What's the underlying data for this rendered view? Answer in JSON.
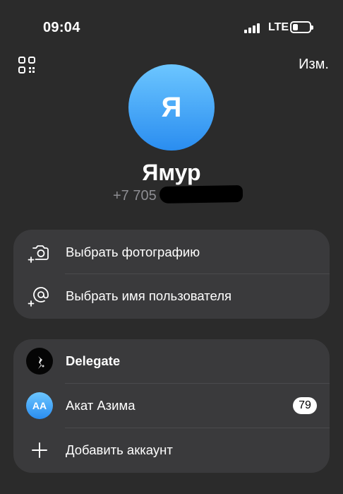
{
  "status_bar": {
    "time": "09:04",
    "network": "LTE",
    "battery_level": 0.15
  },
  "header": {
    "qr_icon": "qr-code-icon",
    "edit_label": "Изм."
  },
  "profile": {
    "avatar_letter": "Я",
    "name": "Ямур",
    "phone_visible": "+7 705",
    "avatar_colors": [
      "#6cc6ff",
      "#2a8df0"
    ]
  },
  "menu": {
    "items": [
      {
        "label": "Выбрать фотографию",
        "icon": "camera-plus-icon"
      },
      {
        "label": "Выбрать имя пользователя",
        "icon": "at-sign-plus-icon"
      }
    ]
  },
  "accounts": {
    "items": [
      {
        "label": "Delegate",
        "avatar": "delegate-avatar"
      },
      {
        "label": "Акат Азима",
        "avatar_initials": "AA",
        "badge": "79"
      }
    ],
    "add_label": "Добавить аккаунт",
    "add_icon": "plus-icon"
  },
  "colors": {
    "background": "#2b2b2b",
    "card": "#3a3a3c",
    "secondary_text": "#8d8d92"
  }
}
